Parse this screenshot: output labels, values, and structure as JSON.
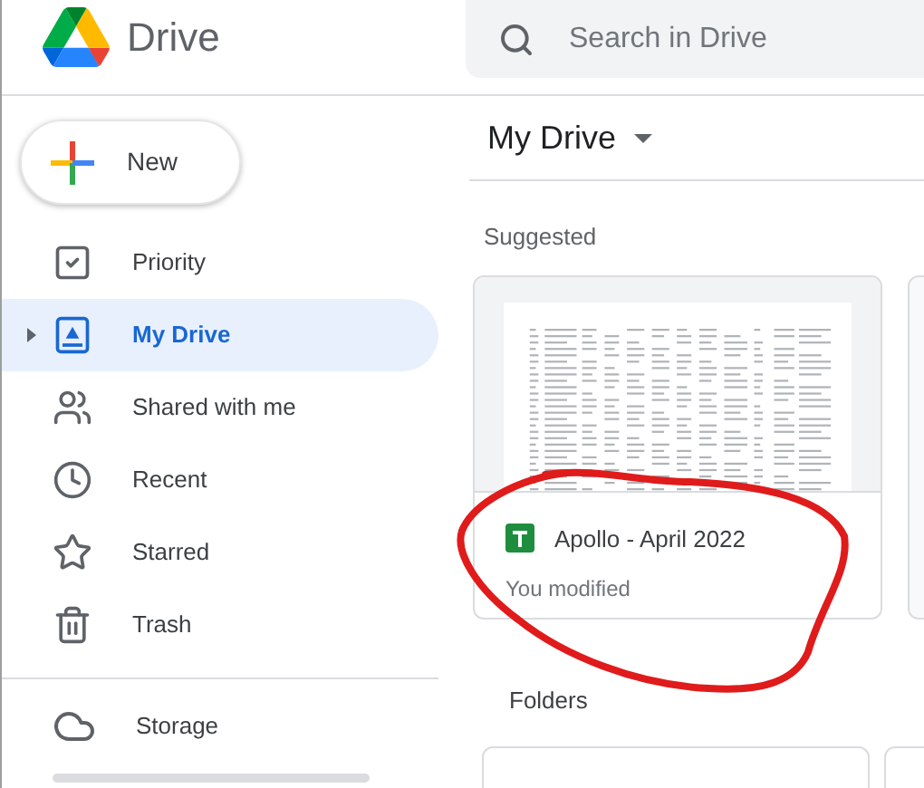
{
  "app": {
    "name": "Drive"
  },
  "search": {
    "placeholder": "Search in Drive"
  },
  "new_button": {
    "label": "New"
  },
  "nav": [
    {
      "label": "Priority",
      "kind": "priority",
      "selected": false,
      "expandable": false
    },
    {
      "label": "My Drive",
      "kind": "drive",
      "selected": true,
      "expandable": true
    },
    {
      "label": "Shared with me",
      "kind": "shared",
      "selected": false,
      "expandable": false
    },
    {
      "label": "Recent",
      "kind": "recent",
      "selected": false,
      "expandable": false
    },
    {
      "label": "Starred",
      "kind": "starred",
      "selected": false,
      "expandable": false
    },
    {
      "label": "Trash",
      "kind": "trash",
      "selected": false,
      "expandable": false
    }
  ],
  "storage": {
    "label": "Storage"
  },
  "main": {
    "title": "My Drive",
    "suggested": {
      "heading": "Suggested",
      "files": [
        {
          "name": "Apollo - April 2022",
          "detail": "You modified",
          "kind": "spreadsheet"
        }
      ]
    },
    "folders": {
      "heading": "Folders"
    }
  }
}
